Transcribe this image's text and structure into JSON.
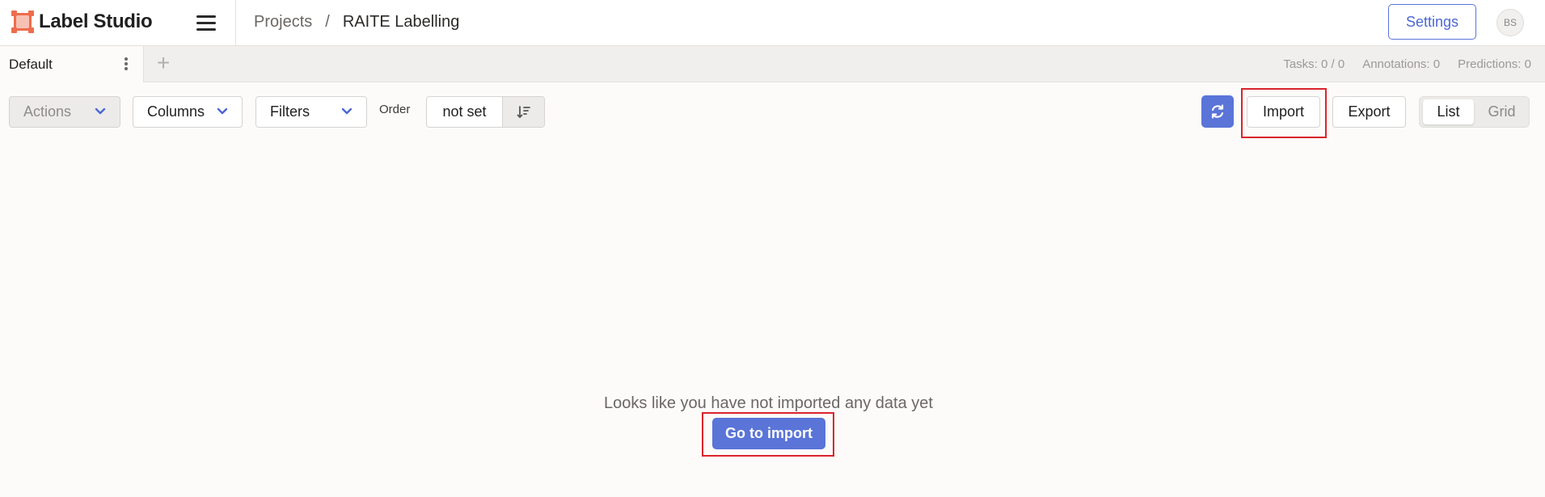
{
  "header": {
    "logo_text": "Label Studio",
    "logo_icon": "label-studio-logo-icon",
    "menu_icon": "hamburger-menu-icon",
    "breadcrumb": {
      "projects": "Projects",
      "separator": "/",
      "current": "RAITE Labelling"
    },
    "settings_label": "Settings",
    "avatar_initials": "BS"
  },
  "tabs": {
    "items": [
      {
        "label": "Default",
        "active": true
      }
    ],
    "menu_icon": "vertical-dots-icon",
    "add_icon": "plus-icon",
    "add_glyph": "+"
  },
  "stats": {
    "tasks": "Tasks: 0 / 0",
    "annotations": "Annotations: 0",
    "predictions": "Predictions: 0"
  },
  "toolbar": {
    "actions_label": "Actions",
    "columns_label": "Columns",
    "filters_label": "Filters",
    "order_label": "Order",
    "order_value": "not set",
    "order_toggle_icon": "sort-descending-icon",
    "refresh_icon": "refresh-icon",
    "import_label": "Import",
    "export_label": "Export",
    "view_options": [
      {
        "label": "List",
        "active": true
      },
      {
        "label": "Grid",
        "active": false
      }
    ]
  },
  "empty_state": {
    "message": "Looks like you have not imported any data yet",
    "button_label": "Go to import"
  },
  "colors": {
    "accent": "#5a74d8",
    "brand_orange": "#ee6c4d",
    "highlight_red": "#d9242b",
    "background": "#fcfbfa"
  }
}
